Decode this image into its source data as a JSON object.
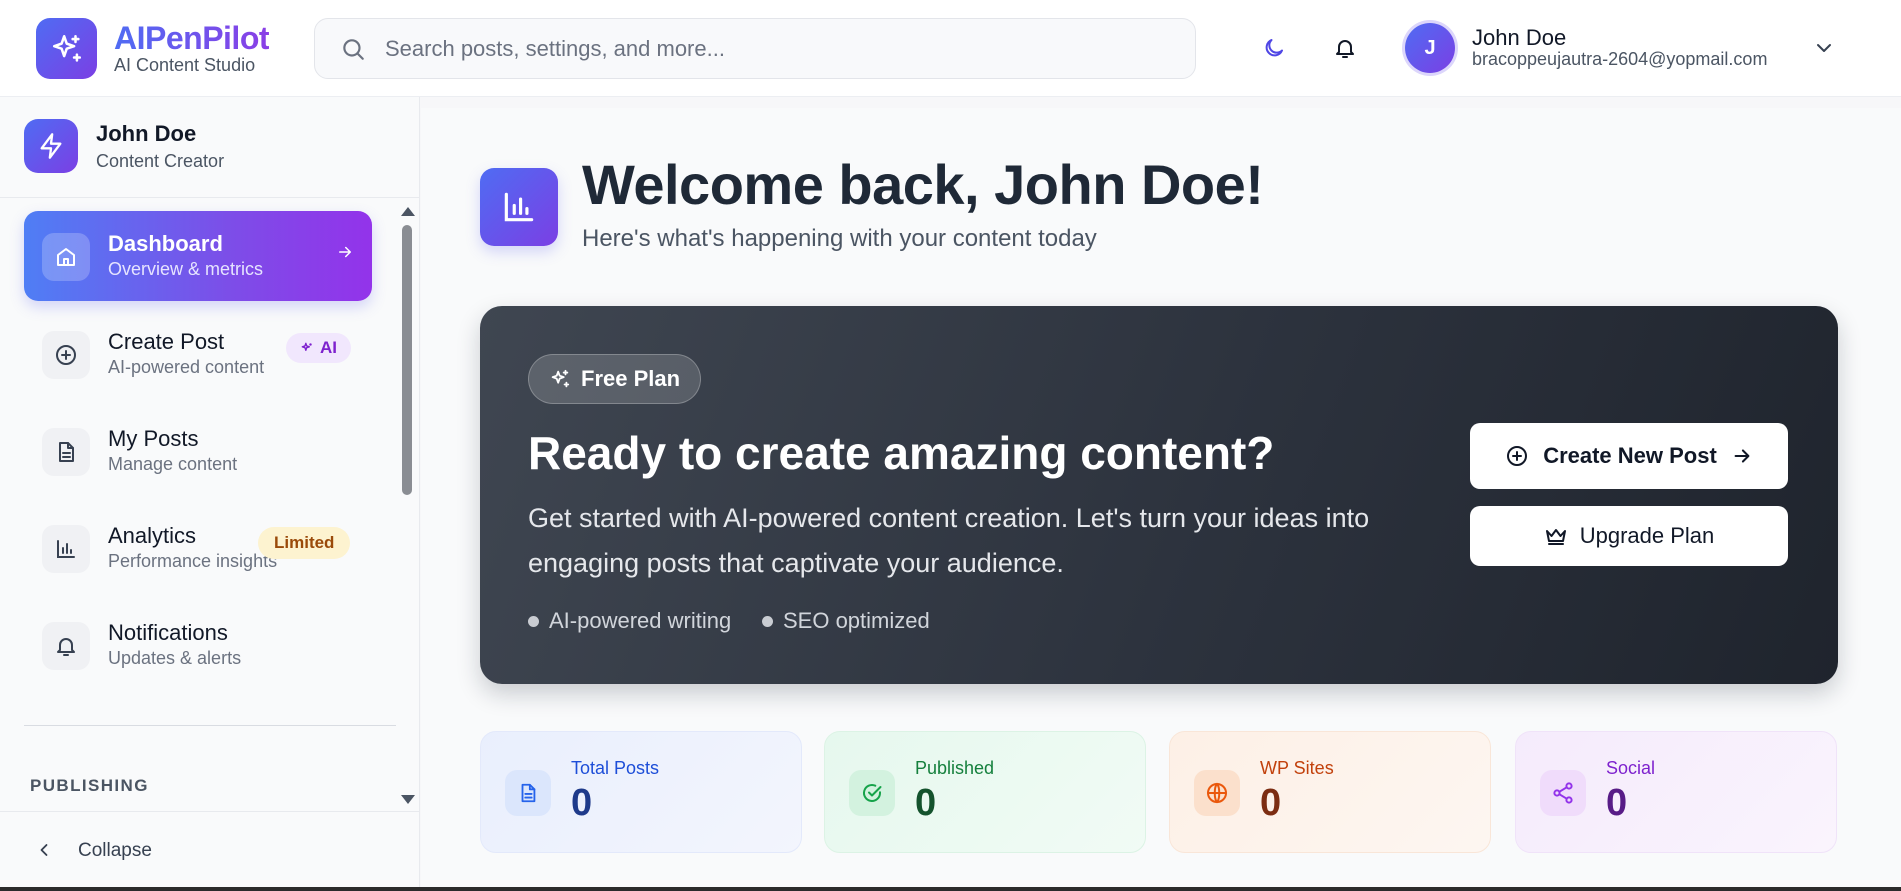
{
  "brand": {
    "name": "AIPenPilot",
    "tagline": "AI Content Studio"
  },
  "search": {
    "placeholder": "Search posts, settings, and more..."
  },
  "header_user": {
    "initial": "J",
    "name": "John Doe",
    "email": "bracoppeujautra-2604@yopmail.com"
  },
  "sidebar": {
    "user": {
      "name": "John Doe",
      "role": "Content Creator"
    },
    "items": [
      {
        "label": "Dashboard",
        "sub": "Overview & metrics",
        "icon": "home-icon",
        "active": true
      },
      {
        "label": "Create Post",
        "sub": "AI-powered content",
        "icon": "plus-circle-icon",
        "badge": "AI"
      },
      {
        "label": "My Posts",
        "sub": "Manage content",
        "icon": "document-icon"
      },
      {
        "label": "Analytics",
        "sub": "Performance insights",
        "icon": "bar-chart-icon",
        "badge": "Limited"
      },
      {
        "label": "Notifications",
        "sub": "Updates & alerts",
        "icon": "bell-icon"
      }
    ],
    "section": "PUBLISHING",
    "collapse": "Collapse"
  },
  "welcome": {
    "title": "Welcome back, John Doe!",
    "subtitle": "Here's what's happening with your content today"
  },
  "hero": {
    "plan": "Free Plan",
    "title": "Ready to create amazing content?",
    "description": "Get started with AI-powered content creation. Let's turn your ideas into engaging posts that captivate your audience.",
    "features": [
      "AI-powered writing",
      "SEO optimized"
    ],
    "primary_button": "Create New Post",
    "secondary_button": "Upgrade Plan"
  },
  "stats": [
    {
      "label": "Total Posts",
      "value": "0",
      "icon": "document-icon"
    },
    {
      "label": "Published",
      "value": "0",
      "icon": "check-circle-icon"
    },
    {
      "label": "WP Sites",
      "value": "0",
      "icon": "globe-icon"
    },
    {
      "label": "Social",
      "value": "0",
      "icon": "share-icon"
    }
  ],
  "colors": {
    "accent_start": "#4f6cf3",
    "accent_end": "#7b3fe4",
    "hero_bg": "#2c323d"
  }
}
